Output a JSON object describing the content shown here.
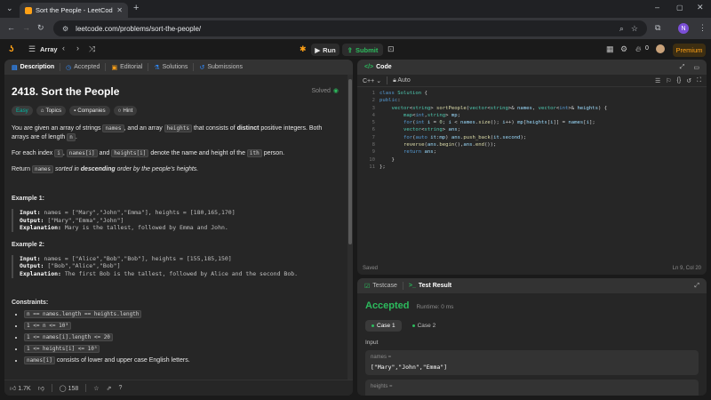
{
  "browser": {
    "tab_title": "Sort the People - LeetCode",
    "url": "leetcode.com/problems/sort-the-people/"
  },
  "topbar": {
    "problem_list": "Array",
    "run_label": "Run",
    "submit_label": "Submit",
    "streak": "0",
    "premium_label": "Premium"
  },
  "left_tabs": {
    "description": "Description",
    "accepted": "Accepted",
    "editorial": "Editorial",
    "solutions": "Solutions",
    "submissions": "Submissions"
  },
  "problem": {
    "title": "2418. Sort the People",
    "status": "Solved",
    "difficulty": "Easy",
    "tag_topics": "Topics",
    "tag_companies": "Companies",
    "tag_hint": "Hint",
    "p1_a": "You are given an array of strings ",
    "p1_code1": "names",
    "p1_b": ", and an array ",
    "p1_code2": "heights",
    "p1_c": " that consists of ",
    "p1_bold": "distinct",
    "p1_d": " positive integers. Both arrays are of length ",
    "p1_code3": "n",
    "p1_e": ".",
    "p2_a": "For each index ",
    "p2_code1": "i",
    "p2_b": ", ",
    "p2_code2": "names[i]",
    "p2_c": " and ",
    "p2_code3": "heights[i]",
    "p2_d": " denote the name and height of the ",
    "p2_code4": "ith",
    "p2_e": " person.",
    "p3_a": "Return ",
    "p3_code": "names",
    "p3_b": " sorted in ",
    "p3_bold": "descending",
    "p3_c": " order by the people's heights.",
    "example1_title": "Example 1:",
    "example1_input_label": "Input:",
    "example1_input": " names = [\"Mary\",\"John\",\"Emma\"], heights = [180,165,170]",
    "example1_output_label": "Output:",
    "example1_output": " [\"Mary\",\"Emma\",\"John\"]",
    "example1_expl_label": "Explanation:",
    "example1_expl": " Mary is the tallest, followed by Emma and John.",
    "example2_title": "Example 2:",
    "example2_input_label": "Input:",
    "example2_input": " names = [\"Alice\",\"Bob\",\"Bob\"], heights = [155,185,150]",
    "example2_output_label": "Output:",
    "example2_output": " [\"Bob\",\"Alice\",\"Bob\"]",
    "example2_expl_label": "Explanation:",
    "example2_expl": " The first Bob is the tallest, followed by Alice and the second Bob.",
    "constraints_title": "Constraints:",
    "constraints": [
      "n == names.length == heights.length",
      "1 <= n <= 10³",
      "1 <= names[i].length <= 20",
      "1 <= heights[i] <= 10⁵"
    ],
    "constraint5_code": "names[i]",
    "constraint5_text": " consists of lower and upper case English letters."
  },
  "footer": {
    "likes": "1.7K",
    "comments": "158"
  },
  "code_panel": {
    "title": "Code",
    "language": "C++",
    "mode": "Auto",
    "status_left": "Saved",
    "status_right": "Ln 9, Col 20",
    "line_numbers": [
      "1",
      "2",
      "3",
      "4",
      "5",
      "6",
      "7",
      "8",
      "9",
      "10",
      "11"
    ]
  },
  "test_panel": {
    "testcase_tab": "Testcase",
    "result_tab": "Test Result",
    "verdict": "Accepted",
    "runtime": "Runtime: 0 ms",
    "case1": "Case 1",
    "case2": "Case 2",
    "input_label": "Input",
    "names_label": "names =",
    "names_value": "[\"Mary\",\"John\",\"Emma\"]",
    "heights_label": "heights ="
  }
}
